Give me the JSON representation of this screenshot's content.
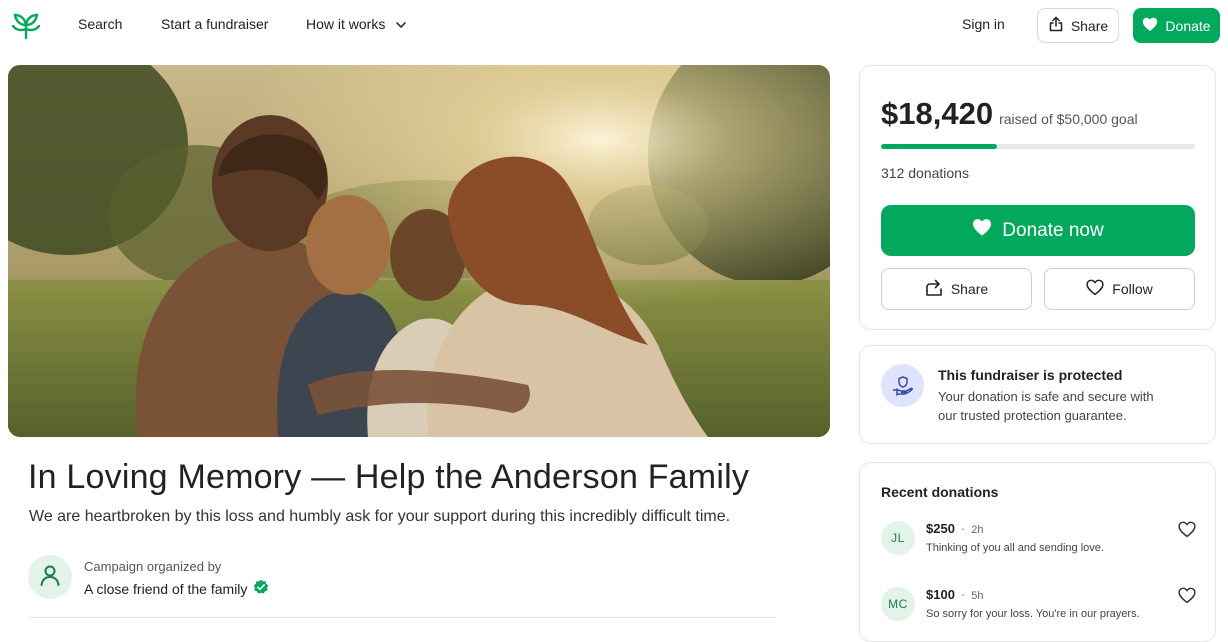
{
  "nav": {
    "search": "Search",
    "start": "Start a fundraiser",
    "how": "How it works",
    "signin": "Sign in",
    "share": "Share",
    "donate": "Donate"
  },
  "campaign": {
    "title": "In Loving Memory — Help the Anderson Family",
    "story": "We are heartbroken by this loss and humbly ask for your support during this incredibly difficult time.",
    "organized_label": "Campaign organized by",
    "organizer": "A close friend of the family"
  },
  "progress": {
    "raised": "$18,420",
    "raised_text": "raised of $50,000 goal",
    "fraction": 0.3684,
    "donations_count": "312 donations"
  },
  "actions": {
    "donate_now": "Donate now",
    "share": "Share",
    "follow": "Follow"
  },
  "protection": {
    "title": "This fundraiser is protected",
    "text": "Your donation is safe and secure with our trusted protection guarantee."
  },
  "recent": {
    "title": "Recent donations",
    "items": [
      {
        "initials": "JL",
        "amount": "$250",
        "time": "2h",
        "message": "Thinking of you all and sending love."
      },
      {
        "initials": "MC",
        "amount": "$100",
        "time": "5h",
        "message": "So sorry for your loss. You're in our prayers."
      }
    ]
  },
  "colors": {
    "brand_green": "#02a95c",
    "protect_badge": "#dfe3fb"
  },
  "icons": {
    "logo": "gofundme-sprout-logo",
    "chevron": "chevron-down-icon",
    "share": "share-icon",
    "heart": "heart-icon",
    "shield": "shield-hand-icon",
    "verified": "verified-badge-icon",
    "person": "person-icon"
  }
}
